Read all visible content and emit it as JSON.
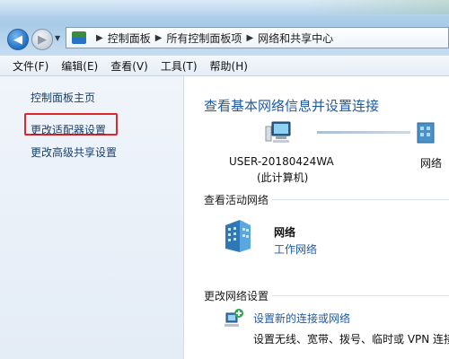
{
  "breadcrumb": [
    "控制面板",
    "所有控制面板项",
    "网络和共享中心"
  ],
  "menu": [
    "文件(F)",
    "编辑(E)",
    "查看(V)",
    "工具(T)",
    "帮助(H)"
  ],
  "left_pane": {
    "home": "控制面板主页",
    "change_adapter": "更改适配器设置",
    "advanced_sharing": "更改高级共享设置"
  },
  "main": {
    "title": "查看基本网络信息并设置连接",
    "computer_name": "USER-20180424WA",
    "computer_sub": "(此计算机)",
    "network_right": "网络",
    "active_section": "查看活动网络",
    "network_name": "网络",
    "network_type": "工作网络",
    "change_section": "更改网络设置",
    "setup_link": "设置新的连接或网络",
    "setup_desc": "设置无线、宽带、拨号、临时或 VPN 连接"
  },
  "icons": {
    "back": "back-arrow-icon",
    "forward": "forward-arrow-icon",
    "computer": "computer-icon",
    "network": "globe-network-icon",
    "building": "network-building-icon",
    "setup": "network-setup-icon"
  },
  "colors": {
    "link_blue": "#1e5aa8",
    "highlight_red": "#e0262a"
  }
}
